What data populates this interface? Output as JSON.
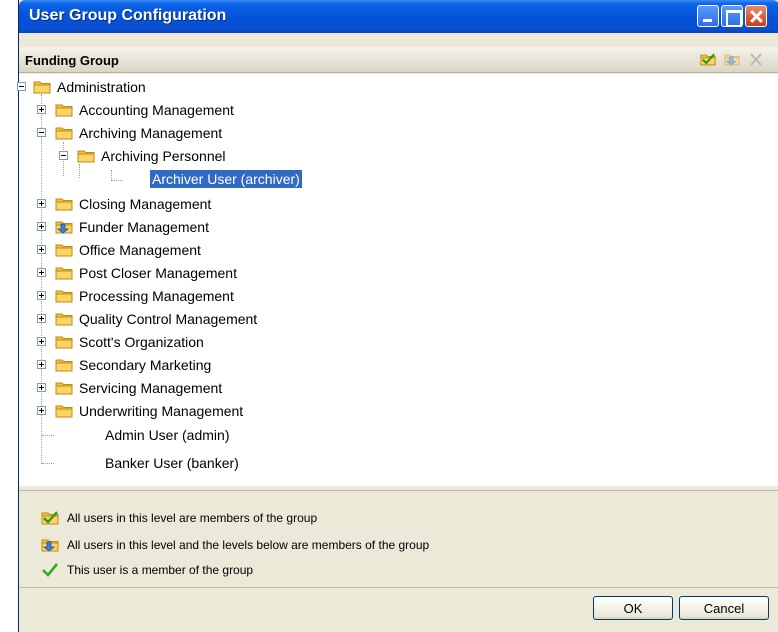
{
  "window": {
    "title": "User Group Configuration"
  },
  "group": {
    "name": "Funding Group"
  },
  "tree": {
    "root": {
      "label": "Administration",
      "icon": "folder-icon",
      "expanded": true
    },
    "children": [
      {
        "label": "Accounting Management",
        "icon": "folder-icon",
        "expanded": false
      },
      {
        "label": "Archiving Management",
        "icon": "folder-icon",
        "expanded": true
      },
      {
        "label": "Archiving Personnel",
        "icon": "folder-icon",
        "expanded": true
      },
      {
        "label": "Archiver User (archiver)",
        "icon": "user",
        "selected": true
      },
      {
        "label": "Closing Management",
        "icon": "folder-icon",
        "expanded": false
      },
      {
        "label": "Funder Management",
        "icon": "folder-members-below-icon",
        "expanded": false
      },
      {
        "label": "Office Management",
        "icon": "folder-icon",
        "expanded": false
      },
      {
        "label": "Post Closer Management",
        "icon": "folder-icon",
        "expanded": false
      },
      {
        "label": "Processing Management",
        "icon": "folder-icon",
        "expanded": false
      },
      {
        "label": "Quality Control Management",
        "icon": "folder-icon",
        "expanded": false
      },
      {
        "label": "Scott's Organization",
        "icon": "folder-icon",
        "expanded": false
      },
      {
        "label": "Secondary Marketing",
        "icon": "folder-icon",
        "expanded": false
      },
      {
        "label": "Servicing Management",
        "icon": "folder-icon",
        "expanded": false
      },
      {
        "label": "Underwriting Management",
        "icon": "folder-icon",
        "expanded": false
      },
      {
        "label": "Admin User (admin)",
        "icon": "user"
      },
      {
        "label": "Banker User (banker)",
        "icon": "user"
      }
    ]
  },
  "legend": [
    {
      "icon": "checked-folder-icon",
      "text": "All users in this level are members of the group"
    },
    {
      "icon": "folder-members-below-icon",
      "text": "All users in this level and the levels below are members of the group"
    },
    {
      "icon": "checkmark-icon",
      "text": "This user is a member of the group"
    }
  ],
  "buttons": {
    "ok": "OK",
    "cancel": "Cancel"
  },
  "colors": {
    "titlebar": "#0553d9",
    "selection": "#316ac5",
    "folder": "#f5c542"
  }
}
